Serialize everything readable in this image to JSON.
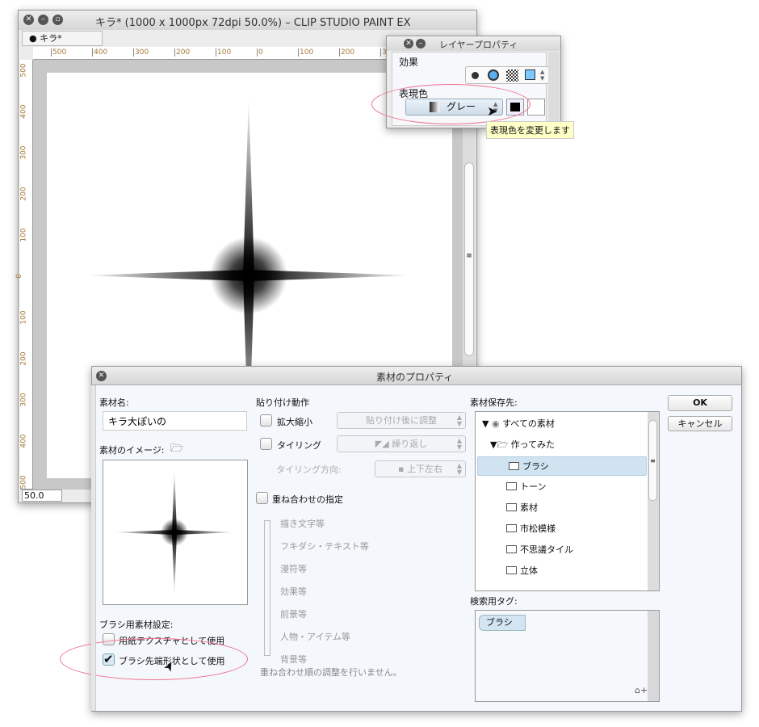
{
  "canvas_window": {
    "title": "キラ* (1000 x 1000px 72dpi 50.0%) – CLIP STUDIO PAINT EX",
    "tab": "キラ*",
    "zoom": "50.0",
    "h_ruler": [
      "500",
      "400",
      "300",
      "200",
      "100",
      "0",
      "100",
      "200",
      "300"
    ],
    "v_ruler": [
      "500",
      "400",
      "300",
      "200",
      "100",
      "0",
      "100",
      "200",
      "300",
      "400",
      "500"
    ]
  },
  "layer_property": {
    "title": "レイヤープロパティ",
    "effect_label": "効果",
    "expression_label": "表現色",
    "expression_value": "グレー",
    "tooltip": "表現色を変更します",
    "icons": [
      "dot-icon",
      "border-icon",
      "tone-icon",
      "layer-color-icon"
    ]
  },
  "dialog": {
    "title": "素材のプロパティ",
    "name_label": "素材名:",
    "name_value": "キラ大ぽいの",
    "image_label": "素材のイメージ:",
    "brush_label": "ブラシ用素材設定:",
    "paper_texture": {
      "label": "用紙テクスチャとして使用",
      "checked": false
    },
    "brush_tip": {
      "label": "ブラシ先端形状として使用",
      "checked": true
    },
    "paste_label": "貼り付け動作",
    "scale": {
      "label": "拡大縮小",
      "checked": false,
      "value": "貼り付け後に調整"
    },
    "tiling": {
      "label": "タイリング",
      "checked": false,
      "value": "繰り返し"
    },
    "tiling_dir": {
      "label": "タイリング方向:",
      "value": "上下左右"
    },
    "overlay": {
      "label": "重ね合わせの指定",
      "checked": false
    },
    "overlay_items": [
      "描き文字等",
      "フキダシ・テキスト等",
      "漫符等",
      "効果等",
      "前景等",
      "人物・アイテム等",
      "背景等"
    ],
    "overlay_note": "重ね合わせ順の調整を行いません。",
    "save_label": "素材保存先:",
    "tree": [
      {
        "label": "すべての素材",
        "level": 0
      },
      {
        "label": "作ってみた",
        "level": 1
      },
      {
        "label": "ブラシ",
        "level": 2,
        "selected": true
      },
      {
        "label": "トーン",
        "level": 2
      },
      {
        "label": "素材",
        "level": 2
      },
      {
        "label": "市松模様",
        "level": 2
      },
      {
        "label": "不思議タイル",
        "level": 2
      },
      {
        "label": "立体",
        "level": 2
      }
    ],
    "tag_label": "検索用タグ:",
    "tags": [
      "ブラシ"
    ],
    "ok": "OK",
    "cancel": "キャンセル"
  },
  "colors": {
    "selection": "#cfe3f1",
    "highlight_ellipse": "#f07090",
    "tooltip_bg": "#ffffc8"
  }
}
